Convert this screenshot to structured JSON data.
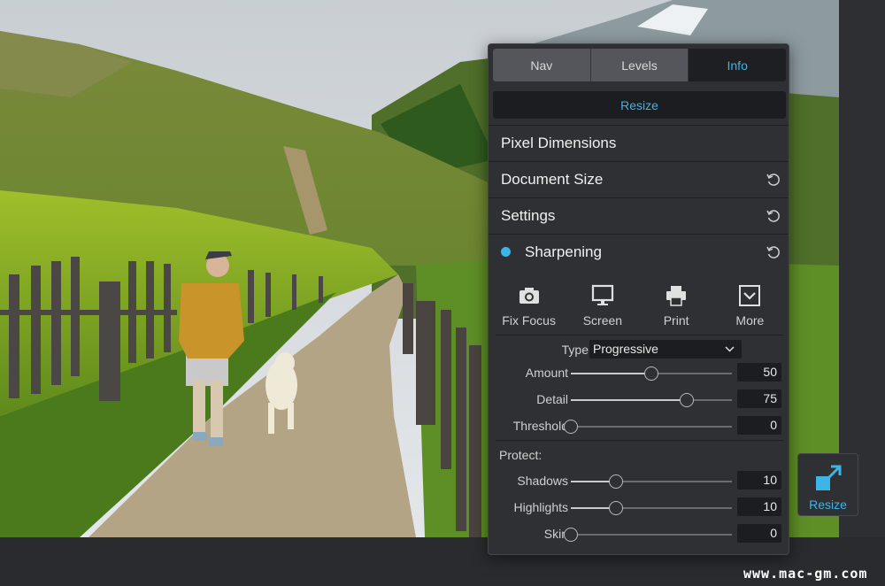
{
  "tabs": [
    {
      "label": "Nav",
      "active": false
    },
    {
      "label": "Levels",
      "active": false
    },
    {
      "label": "Info",
      "active": true
    }
  ],
  "resize_label": "Resize",
  "sections": {
    "pixel_dimensions": "Pixel Dimensions",
    "document_size": "Document Size",
    "settings": "Settings",
    "sharpening": "Sharpening"
  },
  "icons": [
    {
      "label": "Fix Focus",
      "icon": "camera-icon"
    },
    {
      "label": "Screen",
      "icon": "monitor-icon"
    },
    {
      "label": "Print",
      "icon": "printer-icon"
    },
    {
      "label": "More",
      "icon": "chevron-box-icon"
    }
  ],
  "type": {
    "label": "Type",
    "value": "Progressive"
  },
  "sliders": {
    "amount": {
      "label": "Amount",
      "value": "50",
      "fraction": 0.5
    },
    "detail": {
      "label": "Detail",
      "value": "75",
      "fraction": 0.72
    },
    "threshold": {
      "label": "Threshold",
      "value": "0",
      "fraction": 0.0
    }
  },
  "protect": {
    "label": "Protect:",
    "shadows": {
      "label": "Shadows",
      "value": "10",
      "fraction": 0.28
    },
    "highlights": {
      "label": "Highlights",
      "value": "10",
      "fraction": 0.28
    },
    "skin": {
      "label": "Skin",
      "value": "0",
      "fraction": 0.0
    }
  },
  "float_button_label": "Resize",
  "watermark": "www.mac-gm.com",
  "colors": {
    "accent": "#3db4e6",
    "panel": "#2f3034"
  }
}
